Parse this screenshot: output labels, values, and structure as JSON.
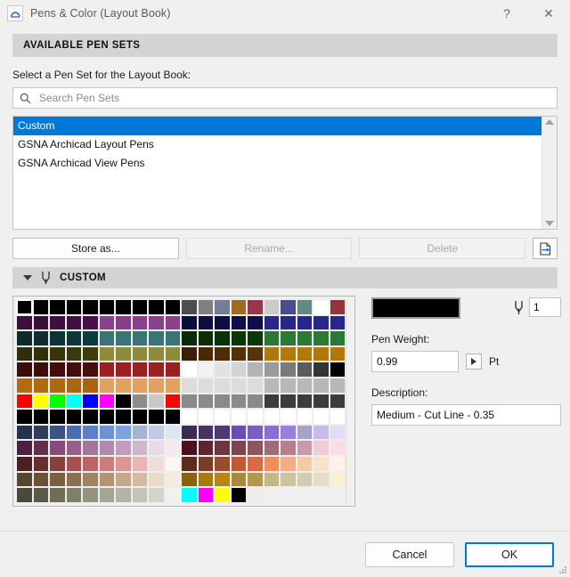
{
  "window": {
    "title": "Pens & Color (Layout Book)",
    "icon": "archicad-app-icon",
    "help_label": "?",
    "close_label": "✕"
  },
  "available_pen_sets": {
    "banner": "AVAILABLE PEN SETS",
    "instruction": "Select a Pen Set for the Layout Book:",
    "search": {
      "placeholder": "Search Pen Sets",
      "value": "",
      "icon": "search-icon"
    },
    "items": [
      {
        "label": "Custom",
        "selected": true
      },
      {
        "label": "GSNA Archicad Layout Pens",
        "selected": false
      },
      {
        "label": "GSNA Archicad View Pens",
        "selected": false
      }
    ],
    "buttons": {
      "store_as": "Store as...",
      "rename": "Rename...",
      "rename_disabled": true,
      "delete": "Delete",
      "delete_disabled": true,
      "export_icon": "export-document-icon"
    }
  },
  "custom_section": {
    "title": "CUSTOM",
    "collapse_icon": "triangle-down-icon",
    "pen_icon": "pen-nib-icon"
  },
  "pen_details": {
    "color_swatch": "#000000",
    "pen_number_label_icon": "pen-nib-icon",
    "pen_number": "1",
    "pen_weight_label": "Pen Weight:",
    "pen_weight_value": "0.99",
    "pen_weight_unit": "Pt",
    "spinner_icon": "spinner-right-icon",
    "description_label": "Description:",
    "description_value": "Medium - Cut Line - 0.35"
  },
  "footer": {
    "cancel": "Cancel",
    "ok": "OK"
  },
  "palette": {
    "columns": 20,
    "rows": 13,
    "selected_index": 0,
    "colors": [
      "#000000",
      "#000000",
      "#000000",
      "#000000",
      "#000000",
      "#000000",
      "#000000",
      "#000000",
      "#000000",
      "#000000",
      "#4d4d4d",
      "#808080",
      "#6e7f96",
      "#a06a22",
      "#99364f",
      "#cbcbcb",
      "#4a4a8e",
      "#628a85",
      "#ffffff",
      "#93333a",
      "#3b0f3b",
      "#390f39",
      "#3d0f3d",
      "#430f43",
      "#4a0f4a",
      "#8c3f8c",
      "#8a3d8a",
      "#8c3f8c",
      "#8c3f8c",
      "#8c3f8c",
      "#0c0c3c",
      "#0d0d40",
      "#0d0d44",
      "#0e0e48",
      "#0e0e4c",
      "#26268c",
      "#26268c",
      "#26268c",
      "#26268c",
      "#26268c",
      "#0d2b2e",
      "#0d2f32",
      "#0d3336",
      "#0d373a",
      "#0d3b3e",
      "#3b7376",
      "#3b7376",
      "#3b7376",
      "#3b7376",
      "#3b7376",
      "#0a2a0a",
      "#0a2e0a",
      "#0a320a",
      "#0a360a",
      "#0a3a0a",
      "#2a7a35",
      "#2a7a35",
      "#2a7a35",
      "#2a7a35",
      "#2a7a35",
      "#2e2e0a",
      "#32320a",
      "#36360a",
      "#3a3a0a",
      "#3e3e0a",
      "#8c8c3a",
      "#8c8c3a",
      "#8c8c3a",
      "#8c8c3a",
      "#8c8c3a",
      "#3a2008",
      "#4a2808",
      "#4e2c08",
      "#52300a",
      "#56340a",
      "#b07a08",
      "#b07a08",
      "#b07a08",
      "#b07a08",
      "#b07a08",
      "#3a0d0d",
      "#3e0d0d",
      "#420d0d",
      "#460d0d",
      "#4a0d0d",
      "#9e1f1f",
      "#9e1f1f",
      "#9e1f1f",
      "#9e1f1f",
      "#9e1f1f",
      "#ffffff",
      "#f2f2f2",
      "#e2e2e2",
      "#d3d3d3",
      "#b4b4b4",
      "#9a9a9a",
      "#7a7a7a",
      "#5c5c5c",
      "#343434",
      "#000000",
      "#b36a12",
      "#b06a12",
      "#ad6812",
      "#ab6612",
      "#a86412",
      "#e0a263",
      "#e0a263",
      "#e0a263",
      "#e0a263",
      "#e0a263",
      "#dcdcdc",
      "#dcdcdc",
      "#dcdcdc",
      "#dcdcdc",
      "#dcdcdc",
      "#b8b8b8",
      "#b8b8b8",
      "#b8b8b8",
      "#b8b8b8",
      "#b8b8b8",
      "#ff0000",
      "#ffff00",
      "#00ff00",
      "#00ffff",
      "#0000ff",
      "#ff00ff",
      "#000000",
      "#8c8c8c",
      "#c8c8c8",
      "#ff0000",
      "#8a8a8a",
      "#8a8a8a",
      "#8a8a8a",
      "#8a8a8a",
      "#8a8a8a",
      "#3c3c3c",
      "#3c3c3c",
      "#3c3c3c",
      "#3c3c3c",
      "#3c3c3c",
      "#000000",
      "#000000",
      "#000000",
      "#000000",
      "#000000",
      "#000000",
      "#000000",
      "#000000",
      "#000000",
      "#000000",
      "#ffffff",
      "#ffffff",
      "#ffffff",
      "#ffffff",
      "#ffffff",
      "#ffffff",
      "#ffffff",
      "#ffffff",
      "#ffffff",
      "#ffffff",
      "#27334d",
      "#2e3d5c",
      "#3e5284",
      "#4c6cb0",
      "#5b80c4",
      "#6f93d0",
      "#7ca3dc",
      "#a5b6d4",
      "#bdcde8",
      "#dde4f4",
      "#3b2a52",
      "#463263",
      "#4e3a73",
      "#6a4fb0",
      "#7a5ec4",
      "#8a6ed0",
      "#9a80dc",
      "#aaa0cc",
      "#c6bbe4",
      "#e2dcf4",
      "#4d2040",
      "#60304f",
      "#8a4a78",
      "#9a5f88",
      "#a57498",
      "#b189ad",
      "#c09cbe",
      "#d2b4cd",
      "#e8dce4",
      "#f2ecf0",
      "#4a1020",
      "#5e2430",
      "#6e3440",
      "#7e4450",
      "#8e5460",
      "#a06a78",
      "#b48090",
      "#c899a8",
      "#f0ccd8",
      "#f8dde4",
      "#4a2020",
      "#64302e",
      "#86403e",
      "#a4504e",
      "#bc6464",
      "#cc7c7c",
      "#dc9494",
      "#e8b4b4",
      "#f0dcdc",
      "#faf6f4",
      "#5a2c1a",
      "#7a3c24",
      "#9a4c2c",
      "#c05a34",
      "#d86b44",
      "#f09058",
      "#f4ad80",
      "#f4cba4",
      "#f8e2cc",
      "#fdf2e8",
      "#5a4430",
      "#6a5138",
      "#7a6040",
      "#8a7050",
      "#a08460",
      "#b49470",
      "#c4a888",
      "#d4bca0",
      "#e8dcc4",
      "#f4ecdc",
      "#8a6408",
      "#a87a0a",
      "#b8860a",
      "#a88a3c",
      "#b49850",
      "#c4b888",
      "#ccc49c",
      "#d4ccb0",
      "#e4dcc4",
      "#fcf0d4",
      "#4a4a3c",
      "#5a5a48",
      "#6e6e54",
      "#80806a",
      "#94947c",
      "#a4a490",
      "#b4b4a4",
      "#c4c4b4",
      "#d4d4c8",
      "#f2f2ec",
      "#00ffff",
      "#ff00ff",
      "#ffff00",
      "#000000",
      "#f0ece8",
      "EMPTY",
      "EMPTY",
      "EMPTY",
      "EMPTY",
      "EMPTY"
    ]
  }
}
